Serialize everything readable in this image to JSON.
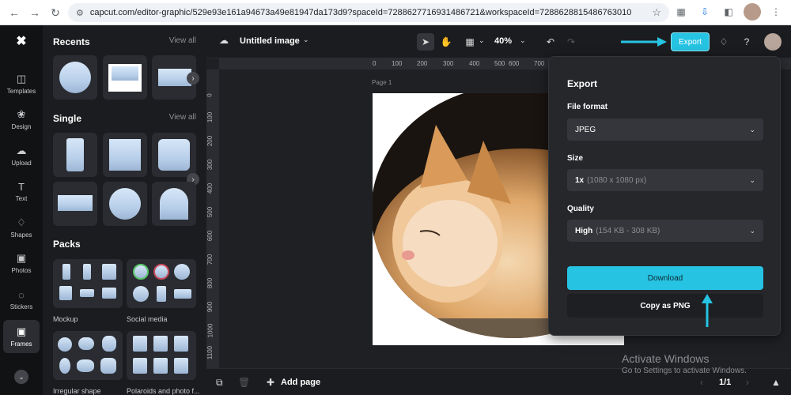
{
  "browser": {
    "url": "capcut.com/editor-graphic/529e93e161a94673a49e81947da173d9?spaceId=7288627716931486721&workspaceId=7288628815486763010"
  },
  "rail": {
    "items": [
      {
        "label": "Templates",
        "icon": "templates-icon"
      },
      {
        "label": "Design",
        "icon": "design-icon"
      },
      {
        "label": "Upload",
        "icon": "upload-icon"
      },
      {
        "label": "Text",
        "icon": "text-icon"
      },
      {
        "label": "Shapes",
        "icon": "shapes-icon"
      },
      {
        "label": "Photos",
        "icon": "photos-icon"
      },
      {
        "label": "Stickers",
        "icon": "stickers-icon"
      },
      {
        "label": "Frames",
        "icon": "frames-icon"
      }
    ]
  },
  "panel": {
    "recents_title": "Recents",
    "single_title": "Single",
    "packs_title": "Packs",
    "view_all": "View all",
    "packs": [
      {
        "label": "Mockup"
      },
      {
        "label": "Social media"
      },
      {
        "label": "Irregular shape"
      },
      {
        "label": "Polaroids and photo f..."
      }
    ]
  },
  "toolbar": {
    "title": "Untitled image",
    "zoom": "40%",
    "export_label": "Export"
  },
  "canvas": {
    "page_label": "Page 1",
    "ruler_top": [
      "0",
      "100",
      "200",
      "300",
      "400",
      "500",
      "600",
      "700"
    ],
    "ruler_left": [
      "0",
      "100",
      "200",
      "300",
      "400",
      "500",
      "600",
      "700",
      "800",
      "900",
      "1000",
      "1100"
    ]
  },
  "export_panel": {
    "title": "Export",
    "file_format_label": "File format",
    "file_format_value": "JPEG",
    "size_label": "Size",
    "size_value": "1x",
    "size_detail": "(1080 x 1080 px)",
    "quality_label": "Quality",
    "quality_value": "High",
    "quality_detail": "(154 KB - 308 KB)",
    "download_label": "Download",
    "copy_label": "Copy as PNG"
  },
  "bottom": {
    "add_page": "Add page",
    "page_count": "1/1"
  },
  "watermark": {
    "line1": "Activate Windows",
    "line2": "Go to Settings to activate Windows."
  },
  "colors": {
    "accent": "#26c3e3",
    "background": "#1b1c1f"
  }
}
